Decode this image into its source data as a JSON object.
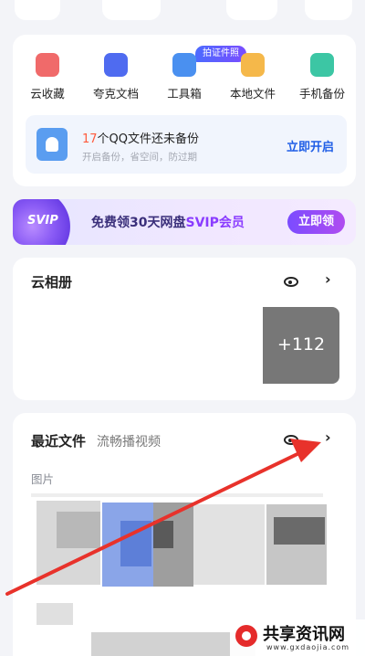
{
  "shortcuts": {
    "badge": "拍证件照",
    "items": [
      {
        "label": "云收藏",
        "icon": "cloud-favorite-icon",
        "color": "#f06a6a"
      },
      {
        "label": "夸克文档",
        "icon": "quark-doc-icon",
        "color": "#4f6bf0"
      },
      {
        "label": "工具箱",
        "icon": "toolbox-icon",
        "color": "#4a90f0"
      },
      {
        "label": "本地文件",
        "icon": "folder-icon",
        "color": "#f5b84a"
      },
      {
        "label": "手机备份",
        "icon": "phone-backup-icon",
        "color": "#3cc6a4"
      }
    ]
  },
  "backup": {
    "count": "17",
    "title_rest": "个QQ文件还未备份",
    "subtitle": "开启备份，省空间，防过期",
    "button": "立即开启"
  },
  "svip": {
    "logo": "SVIP",
    "text_pre": "免费领30天网盘",
    "text_hl": "SVIP会员",
    "button": "立即领"
  },
  "album": {
    "title": "云相册",
    "more_count": "+112"
  },
  "recent": {
    "title": "最近文件",
    "subtitle": "流畅播视频",
    "pictures_label": "图片"
  },
  "watermark": {
    "text": "共享资讯网",
    "url": "www.gxdaojia.com"
  },
  "colors": {
    "accent": "#1f5ee6",
    "warning": "#ff5a3c",
    "arrow": "#e8322b"
  }
}
